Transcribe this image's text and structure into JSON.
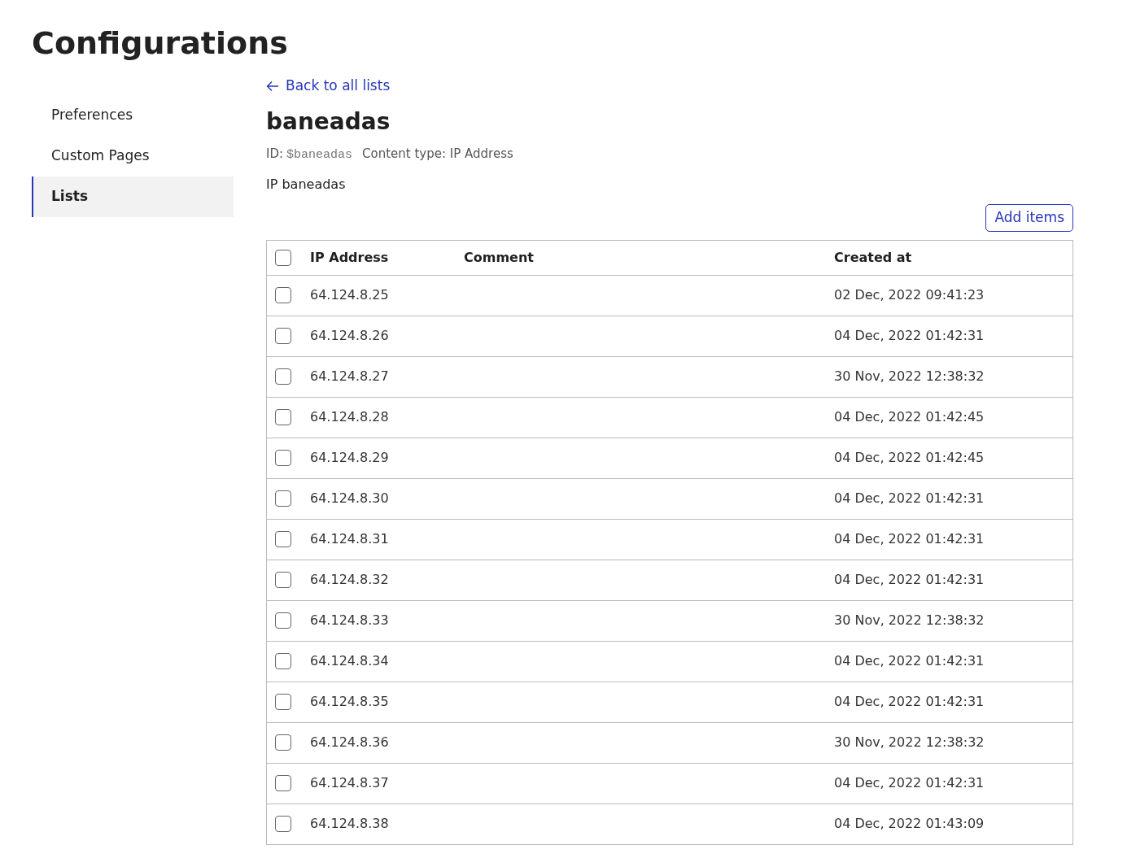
{
  "page_title": "Configurations",
  "sidebar": {
    "items": [
      {
        "label": "Preferences",
        "selected": false
      },
      {
        "label": "Custom Pages",
        "selected": false
      },
      {
        "label": "Lists",
        "selected": true
      }
    ]
  },
  "back_link": "Back to all lists",
  "list": {
    "name": "baneadas",
    "id_label": "ID:",
    "id": "$baneadas",
    "content_type": "Content type: IP Address",
    "description": "IP baneadas"
  },
  "add_button": "Add items",
  "table": {
    "select_all_checked": false,
    "columns": [
      "IP Address",
      "Comment",
      "Created at"
    ],
    "rows": [
      {
        "checked": false,
        "ip": "64.124.8.25",
        "created": "02 Dec, 2022 09:41:23"
      },
      {
        "checked": false,
        "ip": "64.124.8.26",
        "created": "04 Dec, 2022 01:42:31"
      },
      {
        "checked": false,
        "ip": "64.124.8.27",
        "created": "30 Nov, 2022 12:38:32"
      },
      {
        "checked": false,
        "ip": "64.124.8.28",
        "created": "04 Dec, 2022 01:42:45"
      },
      {
        "checked": false,
        "ip": "64.124.8.29",
        "created": "04 Dec, 2022 01:42:45"
      },
      {
        "checked": false,
        "ip": "64.124.8.30",
        "created": "04 Dec, 2022 01:42:31"
      },
      {
        "checked": false,
        "ip": "64.124.8.31",
        "created": "04 Dec, 2022 01:42:31"
      },
      {
        "checked": false,
        "ip": "64.124.8.32",
        "created": "04 Dec, 2022 01:42:31"
      },
      {
        "checked": false,
        "ip": "64.124.8.33",
        "created": "30 Nov, 2022 12:38:32"
      },
      {
        "checked": false,
        "ip": "64.124.8.34",
        "created": "04 Dec, 2022 01:42:31"
      },
      {
        "checked": false,
        "ip": "64.124.8.35",
        "created": "04 Dec, 2022 01:42:31"
      },
      {
        "checked": false,
        "ip": "64.124.8.36",
        "created": "30 Nov, 2022 12:38:32"
      },
      {
        "checked": false,
        "ip": "64.124.8.37",
        "created": "04 Dec, 2022 01:42:31"
      },
      {
        "checked": false,
        "ip": "64.124.8.38",
        "created": "04 Dec, 2022 01:43:09"
      }
    ]
  }
}
